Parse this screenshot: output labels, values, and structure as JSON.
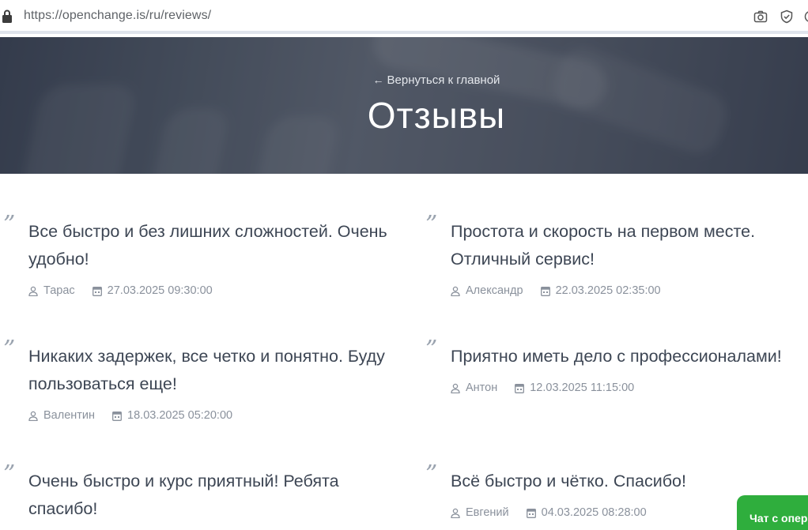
{
  "browser": {
    "url_host": "https://openchange.is",
    "url_path": "/ru/reviews/"
  },
  "hero": {
    "back_label": "Вернуться к главной",
    "title": "Отзывы"
  },
  "reviews": [
    {
      "text": "Все быстро и без лишних сложностей. Очень удобно!",
      "author": "Тарас",
      "date": "27.03.2025 09:30:00"
    },
    {
      "text": "Простота и скорость на первом месте. Отличный сервис!",
      "author": "Александр",
      "date": "22.03.2025 02:35:00"
    },
    {
      "text": "Никаких задержек, все четко и понятно. Буду пользоваться еще!",
      "author": "Валентин",
      "date": "18.03.2025 05:20:00"
    },
    {
      "text": "Приятно иметь дело с профессионалами!",
      "author": "Антон",
      "date": "12.03.2025 11:15:00"
    },
    {
      "text": "Очень быстро и курс приятный! Ребята спасибо!",
      "author": "",
      "date": ""
    },
    {
      "text": "Всё быстро и чётко. Спасибо!",
      "author": "Евгений",
      "date": "04.03.2025 08:28:00"
    }
  ],
  "chat": {
    "label": "Чат с опер"
  },
  "icons": {
    "lock": "lock-icon",
    "camera": "camera-icon",
    "shield": "shield-check-icon",
    "back": "arrow-left-icon",
    "quote": "quote-icon",
    "user": "user-icon",
    "calendar": "calendar-icon"
  }
}
